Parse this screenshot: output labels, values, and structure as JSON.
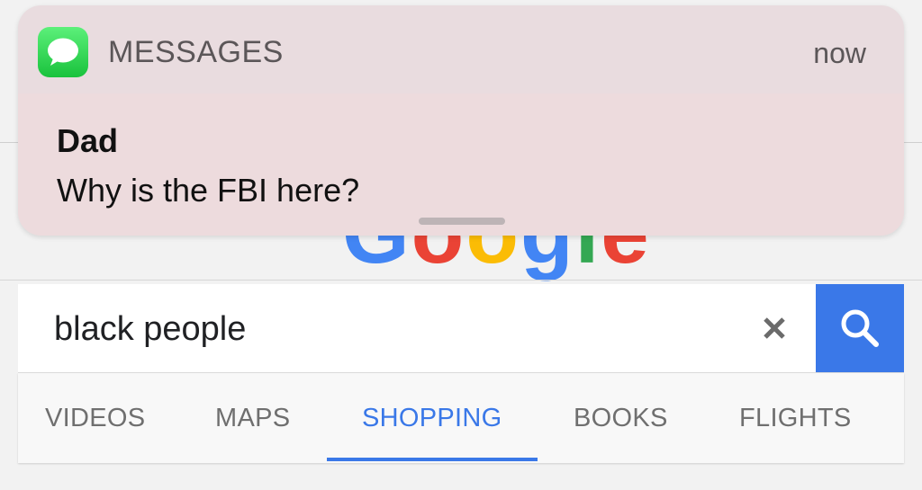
{
  "notification": {
    "app_name": "MESSAGES",
    "time": "now",
    "sender": "Dad",
    "message": "Why is the FBI here?"
  },
  "search": {
    "query": "black people"
  },
  "tabs": [
    {
      "label": "VIDEOS",
      "active": false
    },
    {
      "label": "MAPS",
      "active": false
    },
    {
      "label": "SHOPPING",
      "active": true
    },
    {
      "label": "BOOKS",
      "active": false
    },
    {
      "label": "FLIGHTS",
      "active": false
    }
  ],
  "colors": {
    "accent": "#3a78e8",
    "notification_bg": "#ecdfe1",
    "messages_green": "#2ad04f"
  },
  "icons": {
    "app": "messages-icon",
    "clear": "close-icon",
    "search": "search-icon"
  }
}
